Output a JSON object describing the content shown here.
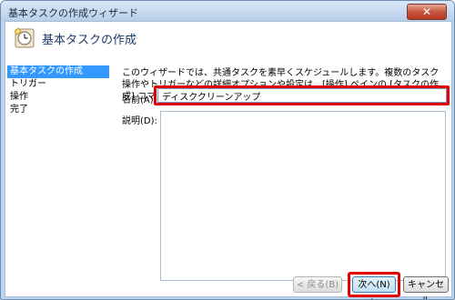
{
  "window": {
    "title": "基本タスクの作成ウィザード",
    "close_label": "✕"
  },
  "header": {
    "title": "基本タスクの作成",
    "icon": "clock-icon"
  },
  "nav": {
    "items": [
      {
        "label": "基本タスクの作成",
        "selected": true
      },
      {
        "label": "トリガー",
        "selected": false
      },
      {
        "label": "操作",
        "selected": false
      },
      {
        "label": "完了",
        "selected": false
      }
    ]
  },
  "main": {
    "description": "このウィザードでは、共通タスクを素早くスケジュールします。複数のタスク操作やトリガーなどの詳細オプションや設定は、[操作] ペインの [タスクの作成] コマンドを使ってください。",
    "name_label": "名前(A):",
    "name_value": "ディスククリーンアップ",
    "description_label": "説明(D):",
    "description_value": ""
  },
  "buttons": {
    "back": "< 戻る(B)",
    "next": "次へ(N) >",
    "cancel": "キャンセル"
  },
  "colors": {
    "highlight": "#e00000",
    "nav_selected": "#3399ff"
  }
}
